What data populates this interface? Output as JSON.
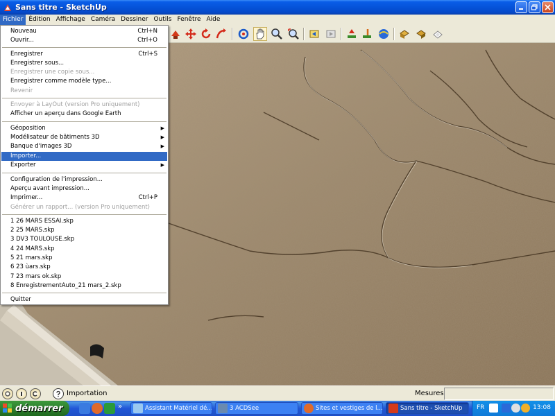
{
  "window": {
    "title": "Sans titre - SketchUp",
    "controls": [
      "minimize",
      "maximize",
      "close"
    ]
  },
  "menubar": {
    "items": [
      "Fichier",
      "Édition",
      "Affichage",
      "Caméra",
      "Dessiner",
      "Outils",
      "Fenêtre",
      "Aide"
    ],
    "active": "Fichier"
  },
  "file_menu": {
    "items": [
      {
        "label": "Nouveau",
        "shortcut": "Ctrl+N"
      },
      {
        "label": "Ouvrir...",
        "shortcut": "Ctrl+O"
      },
      {
        "label": "Enregistrer",
        "shortcut": "Ctrl+S"
      },
      {
        "label": "Enregistrer sous..."
      },
      {
        "label": "Enregistrer une copie sous...",
        "disabled": true
      },
      {
        "label": "Enregistrer comme modèle type..."
      },
      {
        "label": "Revenir",
        "disabled": true
      },
      {
        "label": "Envoyer à LayOut (version Pro uniquement)",
        "disabled": true
      },
      {
        "label": "Afficher un aperçu dans Google Earth"
      },
      {
        "label": "Géoposition",
        "submenu": true
      },
      {
        "label": "Modélisateur de bâtiments 3D",
        "submenu": true
      },
      {
        "label": "Banque d'images 3D",
        "submenu": true
      },
      {
        "label": "Importer...",
        "highlighted": true
      },
      {
        "label": "Exporter",
        "submenu": true
      },
      {
        "label": "Configuration de l'impression..."
      },
      {
        "label": "Aperçu avant impression..."
      },
      {
        "label": "Imprimer...",
        "shortcut": "Ctrl+P"
      },
      {
        "label": "Générer un rapport... (version Pro uniquement)",
        "disabled": true
      },
      {
        "label": "1 26 MARS ESSAI.skp"
      },
      {
        "label": "2 25 MARS.skp"
      },
      {
        "label": "3 DV3 TOULOUSE.skp"
      },
      {
        "label": "4 24 MARS.skp"
      },
      {
        "label": "5 21 mars.skp"
      },
      {
        "label": "6 23 ùars.skp"
      },
      {
        "label": "7 23 mars ok.skp"
      },
      {
        "label": "8 EnregistrementAuto_21 mars_2.skp"
      },
      {
        "label": "Quitter"
      }
    ]
  },
  "toolbar": {
    "icons": [
      "push-pull-icon",
      "move-icon",
      "rotate-icon",
      "follow-me-icon",
      "orbit-icon",
      "pan-icon",
      "zoom-icon",
      "zoom-extents-icon",
      "previous-view-icon",
      "next-view-icon",
      "add-location-icon",
      "toggle-terrain-icon",
      "get-models-icon",
      "share-model-icon",
      "components-icon",
      "materials-icon",
      "styles-icon"
    ]
  },
  "statusbar": {
    "status_text": "Importation",
    "measure_label": "Mesures",
    "measure_value": ""
  },
  "taskbar": {
    "start_label": "démarrer",
    "tasks": [
      {
        "label": "Assistant Matériel dé...",
        "active": false
      },
      {
        "label": "3 ACDSee",
        "active": false
      },
      {
        "label": "Sites et vestiges de l...",
        "active": false
      },
      {
        "label": "Sans titre - SketchUp",
        "active": true
      }
    ],
    "language": "FR",
    "clock": "13:08",
    "chevron": "»"
  },
  "colors": {
    "menu_highlight": "#316ac5",
    "title_blue": "#0553d9",
    "terrain": "#a89478",
    "start_green": "#2c7a2c"
  }
}
